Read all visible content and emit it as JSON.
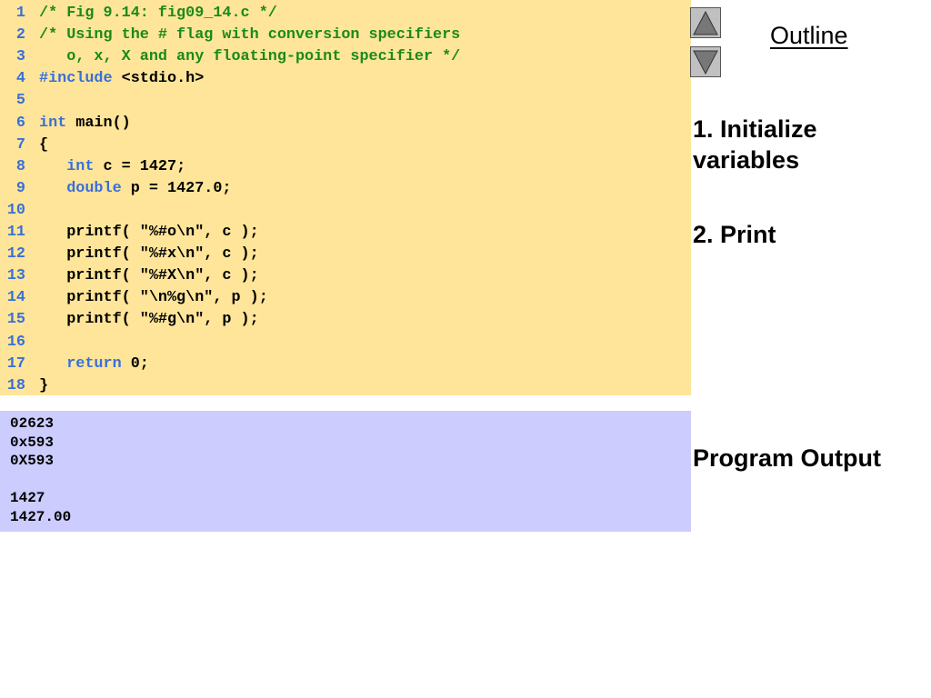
{
  "code_lines": [
    [
      [
        "cm",
        "/* Fig 9.14: fig09_14.c */"
      ]
    ],
    [
      [
        "cm",
        "/* Using the # flag with conversion specifiers"
      ]
    ],
    [
      [
        "cm",
        "   o, x, X and any floating-point specifier */"
      ]
    ],
    [
      [
        "kw",
        "#include"
      ],
      [
        "tx",
        " <stdio.h>"
      ]
    ],
    [],
    [
      [
        "kw",
        "int"
      ],
      [
        "tx",
        " main()"
      ]
    ],
    [
      [
        "tx",
        "{"
      ]
    ],
    [
      [
        "tx",
        "   "
      ],
      [
        "kw",
        "int"
      ],
      [
        "tx",
        " c = 1427;"
      ]
    ],
    [
      [
        "tx",
        "   "
      ],
      [
        "kw",
        "double"
      ],
      [
        "tx",
        " p = 1427.0;"
      ]
    ],
    [],
    [
      [
        "tx",
        "   printf( \"%#o\\n\", c );"
      ]
    ],
    [
      [
        "tx",
        "   printf( \"%#x\\n\", c );"
      ]
    ],
    [
      [
        "tx",
        "   printf( \"%#X\\n\", c );"
      ]
    ],
    [
      [
        "tx",
        "   printf( \"\\n%g\\n\", p );"
      ]
    ],
    [
      [
        "tx",
        "   printf( \"%#g\\n\", p );"
      ]
    ],
    [],
    [
      [
        "tx",
        "   "
      ],
      [
        "kw",
        "return"
      ],
      [
        "tx",
        " 0;"
      ]
    ],
    [
      [
        "tx",
        "}"
      ]
    ]
  ],
  "output_lines": [
    "02623",
    "0x593",
    "0X593",
    "",
    "1427",
    "1427.00"
  ],
  "outline": {
    "title": "Outline",
    "prev_icon": "triangle-up-icon",
    "next_icon": "triangle-down-icon"
  },
  "steps": {
    "s1_a": "1. Initialize",
    "s1_b": "variables",
    "s2": "2. Print",
    "s3": "Program Output"
  }
}
